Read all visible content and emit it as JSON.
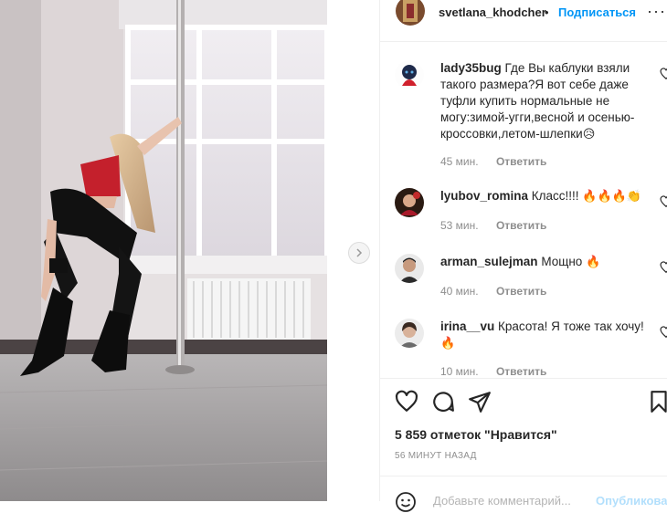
{
  "post": {
    "author": "svetlana_khodcher",
    "separator": "•",
    "follow_label": "Подписаться",
    "more_label": "···"
  },
  "comments": [
    {
      "user": "lady35bug",
      "text": "Где Вы каблуки взяли такого размера?Я вот себе даже туфли купить нормальные не могу:зимой-угги,весной и осенью-кроссовки,летом-шлепки",
      "emoji": "😥",
      "time": "45 мин.",
      "reply": "Ответить"
    },
    {
      "user": "lyubov_romina",
      "text": "Класс!!!!",
      "emoji": "🔥🔥🔥👏",
      "time": "53 мин.",
      "reply": "Ответить"
    },
    {
      "user": "arman_sulejman",
      "text": "Мощно",
      "emoji": "🔥",
      "time": "40 мин.",
      "reply": "Ответить"
    },
    {
      "user": "irina__vu",
      "text": "Красота! Я тоже так хочу!",
      "emoji": "🔥",
      "time": "10 мин.",
      "reply": "Ответить"
    }
  ],
  "likes_text": "5 859 отметок \"Нравится\"",
  "time_ago": "56 МИНУТ НАЗАД",
  "comment_input": {
    "placeholder": "Добавьте комментарий...",
    "post_label": "Опубликовать"
  },
  "icons": {
    "like": "heart-icon",
    "comment": "speech-bubble-icon",
    "share": "paper-plane-icon",
    "save": "bookmark-icon",
    "next": "chevron-right-icon",
    "emoji": "smiley-icon",
    "more": "ellipsis-icon"
  },
  "colors": {
    "accent": "#0095f6",
    "muted": "#8e8e8e",
    "text": "#262626"
  }
}
